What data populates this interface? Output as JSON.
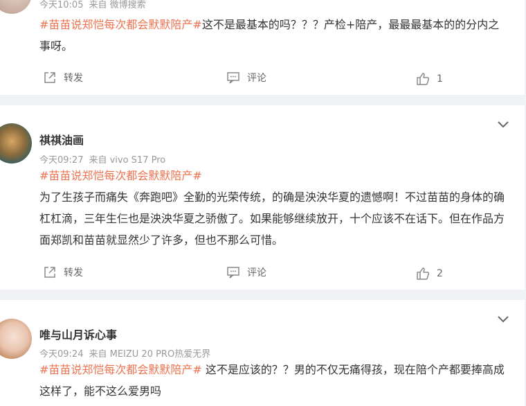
{
  "comments": [
    {
      "meta_time": "今天10:05",
      "meta_source": "来自 微博搜索",
      "tag": "#苗苗说郑恺每次都会默默陪产#",
      "text": "这不是最基本的吗？？？产检+陪产，最最最基本的的分内之事呀。",
      "repost_label": "转发",
      "comment_label": "评论",
      "like_count": "1"
    },
    {
      "username": "祺祺油画",
      "meta_time": "今天09:27",
      "meta_source": "来自 vivo S17 Pro",
      "tag": "#苗苗说郑恺每次都会默默陪产#",
      "text": "为了生孩子而痛失《奔跑吧》全勤的光荣传统，的确是泱泱华夏的遗憾啊！不过苗苗的身体的确杠杠滴，三年生仨也是泱泱华夏之骄傲了。如果能够继续放开，十个应该不在话下。但在作品方面郑凯和苗苗就显然少了许多，但也不那么可惜。",
      "repost_label": "转发",
      "comment_label": "评论",
      "like_count": "2"
    },
    {
      "username": "唯与山月诉心事",
      "meta_time": "今天09:24",
      "meta_source": "来自 MEIZU 20 PRO热爱无界",
      "tag": "#苗苗说郑恺每次都会默默陪产#",
      "text": " 这不是应该的？？男的不仅无痛得孩，现在陪个产都要捧高成这样了，能不这么爱男吗"
    }
  ],
  "icons": {
    "repost": "share-icon",
    "comment": "comment-icon",
    "like": "thumbs-up-icon",
    "expand": "chevron-down-icon"
  },
  "colors": {
    "tag": "#eb7350",
    "meta": "#999999",
    "background": "#f1f2f5"
  }
}
